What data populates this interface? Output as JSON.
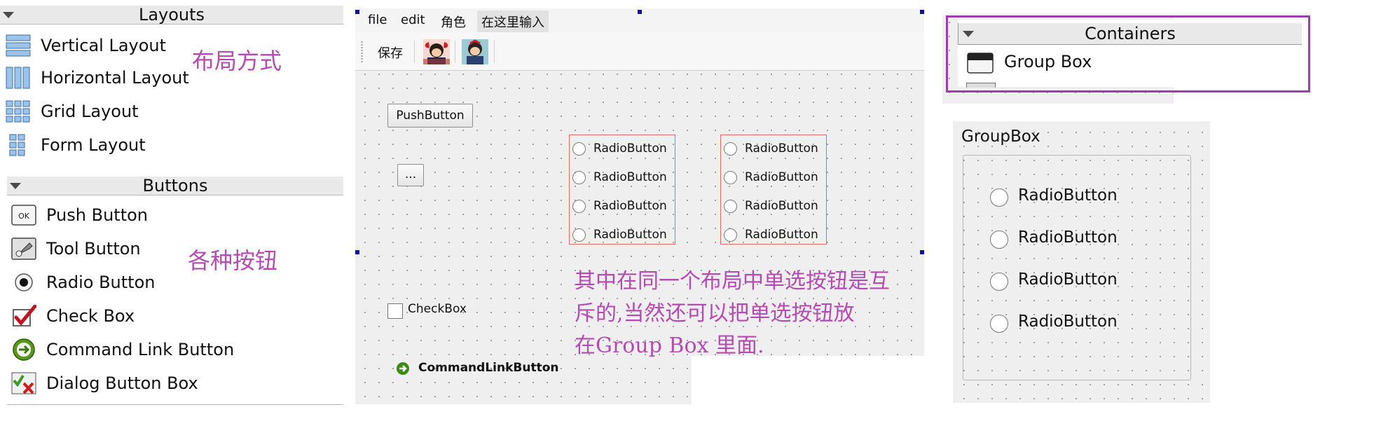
{
  "widget_box": {
    "layouts": {
      "header": "Layouts",
      "items": [
        {
          "label": "Vertical Layout",
          "icon": "vertical-layout-icon"
        },
        {
          "label": "Horizontal Layout",
          "icon": "horizontal-layout-icon"
        },
        {
          "label": "Grid Layout",
          "icon": "grid-layout-icon"
        },
        {
          "label": "Form Layout",
          "icon": "form-layout-icon"
        }
      ],
      "annotation": "布局方式"
    },
    "buttons": {
      "header": "Buttons",
      "items": [
        {
          "label": "Push Button",
          "icon": "push-button-icon"
        },
        {
          "label": "Tool Button",
          "icon": "tool-button-icon"
        },
        {
          "label": "Radio Button",
          "icon": "radio-button-icon"
        },
        {
          "label": "Check Box",
          "icon": "check-box-icon"
        },
        {
          "label": "Command Link Button",
          "icon": "command-link-icon"
        },
        {
          "label": "Dialog Button Box",
          "icon": "dialog-button-box-icon"
        }
      ],
      "annotation": "各种按钮"
    }
  },
  "form": {
    "menu": [
      "file",
      "edit",
      "角色",
      "在这里输入"
    ],
    "toolbar": {
      "save_label": "保存",
      "icons": [
        "character-1-icon",
        "character-2-icon"
      ]
    },
    "push_button": "PushButton",
    "tool_button": "...",
    "radio_groups": [
      [
        "RadioButton",
        "RadioButton",
        "RadioButton",
        "RadioButton"
      ],
      [
        "RadioButton",
        "RadioButton",
        "RadioButton",
        "RadioButton"
      ]
    ],
    "checkbox": "CheckBox",
    "command_link": "CommandLinkButton",
    "annotation_lines": [
      "其中在同一个布局中单选按钮是互",
      "斥的,当然还可以把单选按钮放",
      "在Group Box 里面."
    ]
  },
  "containers": {
    "header": "Containers",
    "item": "Group Box"
  },
  "group_box": {
    "title": "GroupBox",
    "radios": [
      "RadioButton",
      "RadioButton",
      "RadioButton",
      "RadioButton"
    ]
  },
  "colors": {
    "annotation": "#b54ab3",
    "highlight_border": "#a13bb0",
    "layout_border": "#e06a6a"
  }
}
